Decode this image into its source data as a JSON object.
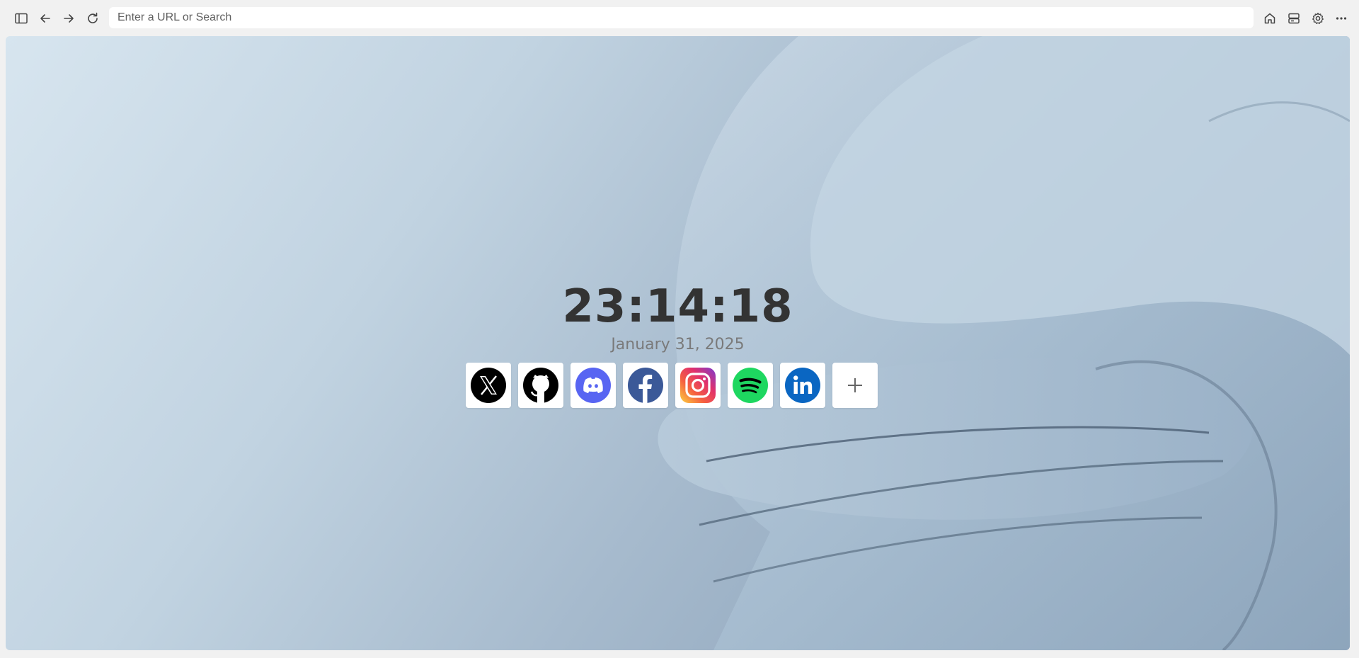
{
  "toolbar": {
    "icons": [
      "sidebar-icon",
      "back-arrow-icon",
      "forward-arrow-icon",
      "reload-icon",
      "home-icon",
      "storage-icon",
      "gear-icon",
      "more-icon"
    ],
    "url_placeholder": "Enter a URL or Search",
    "url_value": ""
  },
  "newtab": {
    "time": "23:14:18",
    "date": "January 31, 2025",
    "shortcuts": [
      {
        "icon": "x-icon",
        "color": "#000000"
      },
      {
        "icon": "github-icon",
        "color": "#000000"
      },
      {
        "icon": "discord-icon",
        "color": "#5865f2"
      },
      {
        "icon": "facebook-icon",
        "color": "#3b5998"
      },
      {
        "icon": "instagram-icon",
        "color": "#e1306c"
      },
      {
        "icon": "spotify-icon",
        "color": "#1ed760"
      },
      {
        "icon": "linkedin-icon",
        "color": "#0a66c2"
      },
      {
        "icon": "plus-icon",
        "color": "#666666"
      }
    ]
  },
  "colors": {
    "toolbar_bg": "#f1f1f1",
    "clock_text": "#333333",
    "date_text": "#7a7a7a"
  }
}
